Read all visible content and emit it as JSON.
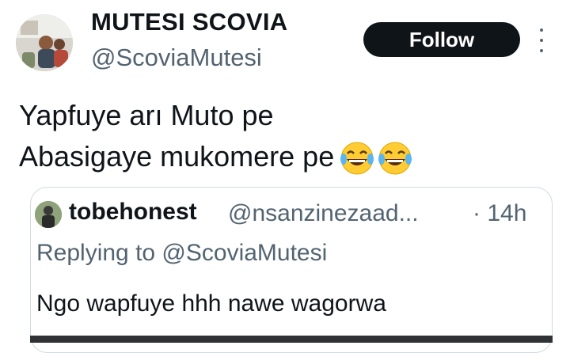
{
  "author": {
    "display_name": "MUTESI SCOVIA",
    "handle": "@ScoviaMutesi",
    "avatar_icon": "profile-photo"
  },
  "actions": {
    "follow_label": "Follow",
    "more_icon": "more-vertical-icon"
  },
  "tweet": {
    "lines": [
      "Yapfuye arı Muto pe",
      "Abasigaye mukomere pe"
    ],
    "emojis": [
      "face-with-tears-of-joy",
      "face-with-tears-of-joy"
    ]
  },
  "quoted": {
    "display_name": "tobehonest",
    "handle": "@nsanzinezaad...",
    "time": "· 14h",
    "replying_to": "Replying to @ScoviaMutesi",
    "text": "Ngo wapfuye hhh nawe wagorwa",
    "avatar_icon": "profile-photo"
  },
  "colors": {
    "text": "#0f1419",
    "secondary": "#536471",
    "button_bg": "#0f1419",
    "border": "#cfd9de",
    "emoji_yellow": "#ffcc33"
  }
}
